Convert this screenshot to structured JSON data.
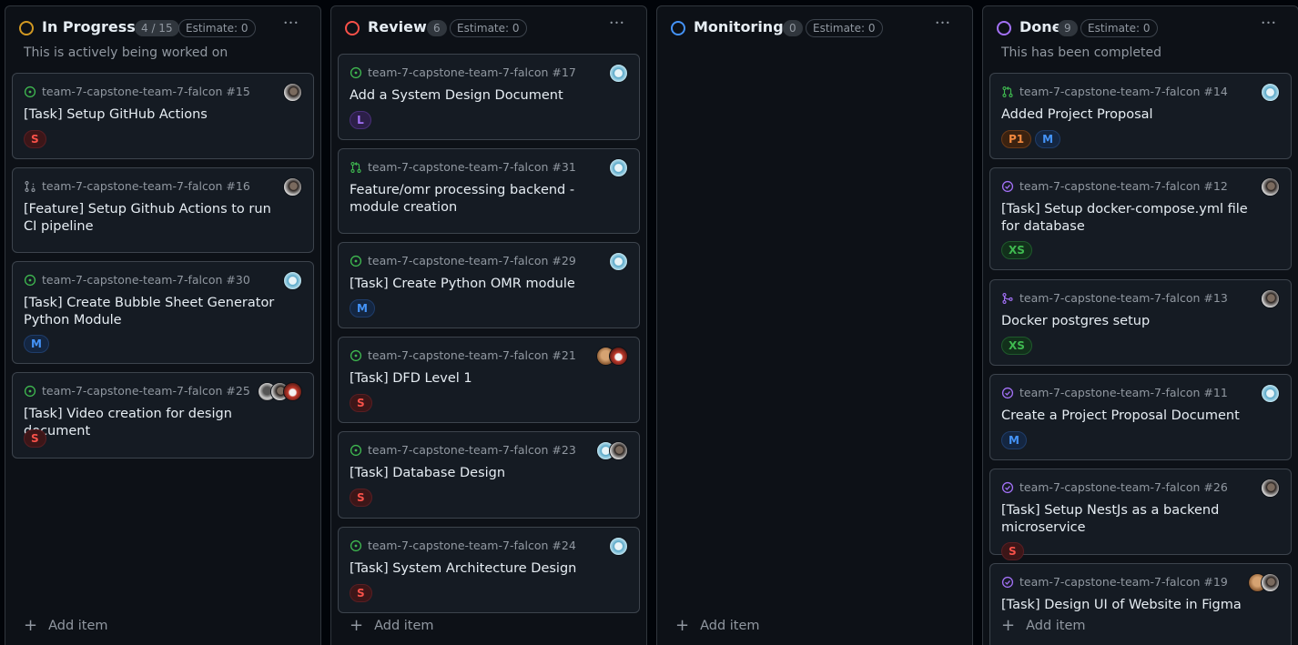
{
  "colors": {
    "open_issue": "#3fb950",
    "open_pr": "#3fb950",
    "draft": "#9198a1",
    "merged_pr": "#a371f7",
    "closed_issue": "#a371f7"
  },
  "add_item_label": "Add item",
  "columns": [
    {
      "name": "In Progress",
      "count": "4 / 15",
      "estimate": "Estimate: 0",
      "status_color": "#d29922",
      "description": "This is actively being worked on",
      "cards": [
        {
          "repo": "team-7-capstone-team-7-falcon #15",
          "title": "[Task] Setup GitHub Actions",
          "labels": [
            "S"
          ],
          "icon": "open-issue-icon",
          "avatars": [
            "dark"
          ]
        },
        {
          "repo": "team-7-capstone-team-7-falcon #16",
          "title": "[Feature] Setup Github Actions to run CI pipeline",
          "labels": [],
          "icon": "draft-pr-icon",
          "avatars": [
            "dark"
          ]
        },
        {
          "repo": "team-7-capstone-team-7-falcon #30",
          "title": "[Task] Create Bubble Sheet Generator Python Module",
          "labels": [
            "M"
          ],
          "icon": "open-issue-icon",
          "avatars": [
            "light"
          ]
        },
        {
          "repo": "team-7-capstone-team-7-falcon #25",
          "title": "[Task] Video creation for design document",
          "labels": [
            "S"
          ],
          "icon": "open-issue-icon",
          "avatars": [
            "gray",
            "dark",
            "red"
          ]
        }
      ]
    },
    {
      "name": "Review",
      "count": "6",
      "estimate": "Estimate: 0",
      "status_color": "#f85149",
      "description": "",
      "cards": [
        {
          "repo": "team-7-capstone-team-7-falcon #17",
          "title": "Add a System Design Document",
          "labels": [
            "L"
          ],
          "icon": "open-issue-icon",
          "avatars": [
            "light"
          ]
        },
        {
          "repo": "team-7-capstone-team-7-falcon #31",
          "title": "Feature/omr processing backend - module creation",
          "labels": [],
          "icon": "open-pr-icon",
          "avatars": [
            "light"
          ]
        },
        {
          "repo": "team-7-capstone-team-7-falcon #29",
          "title": "[Task] Create Python OMR module",
          "labels": [
            "M"
          ],
          "icon": "open-issue-icon",
          "avatars": [
            "light"
          ]
        },
        {
          "repo": "team-7-capstone-team-7-falcon #21",
          "title": "[Task] DFD Level 1",
          "labels": [
            "S"
          ],
          "icon": "open-issue-icon",
          "avatars": [
            "tan",
            "red"
          ]
        },
        {
          "repo": "team-7-capstone-team-7-falcon #23",
          "title": "[Task] Database Design",
          "labels": [
            "S"
          ],
          "icon": "open-issue-icon",
          "avatars": [
            "light",
            "dark"
          ]
        },
        {
          "repo": "team-7-capstone-team-7-falcon #24",
          "title": "[Task] System Architecture Design",
          "labels": [
            "S"
          ],
          "icon": "open-issue-icon",
          "avatars": [
            "light"
          ]
        }
      ]
    },
    {
      "name": "Monitoring",
      "count": "0",
      "estimate": "Estimate: 0",
      "status_color": "#4493f8",
      "description": "",
      "cards": []
    },
    {
      "name": "Done",
      "count": "9",
      "estimate": "Estimate: 0",
      "status_color": "#a371f7",
      "description": "This has been completed",
      "cards": [
        {
          "repo": "team-7-capstone-team-7-falcon #14",
          "title": "Added Project Proposal",
          "labels": [
            "P1",
            "M"
          ],
          "icon": "open-pr-icon",
          "avatars": [
            "light"
          ]
        },
        {
          "repo": "team-7-capstone-team-7-falcon #12",
          "title": "[Task] Setup docker-compose.yml file for database",
          "labels": [
            "XS"
          ],
          "icon": "closed-issue-icon",
          "avatars": [
            "dark"
          ]
        },
        {
          "repo": "team-7-capstone-team-7-falcon #13",
          "title": "Docker postgres setup",
          "labels": [
            "XS"
          ],
          "icon": "merged-pr-icon",
          "avatars": [
            "dark"
          ]
        },
        {
          "repo": "team-7-capstone-team-7-falcon #11",
          "title": "Create a Project Proposal Document",
          "labels": [
            "M"
          ],
          "icon": "closed-issue-icon",
          "avatars": [
            "light"
          ]
        },
        {
          "repo": "team-7-capstone-team-7-falcon #26",
          "title": "[Task] Setup NestJs as a backend microservice",
          "labels": [
            "S"
          ],
          "icon": "closed-issue-icon",
          "avatars": [
            "dark"
          ]
        },
        {
          "repo": "team-7-capstone-team-7-falcon #19",
          "title": "[Task] Design UI of Website in Figma",
          "labels": [],
          "icon": "closed-issue-icon",
          "avatars": [
            "tan",
            "dark"
          ]
        }
      ]
    }
  ]
}
